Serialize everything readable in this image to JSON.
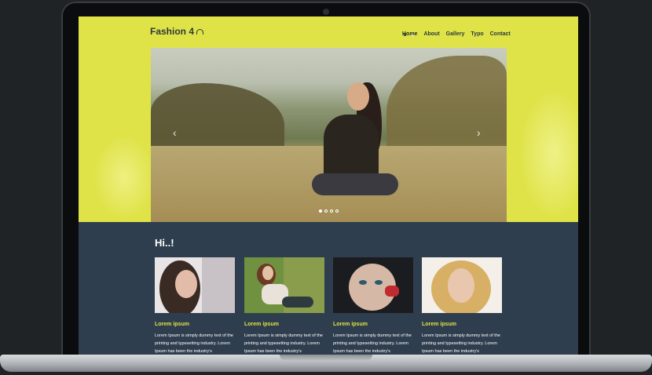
{
  "site": {
    "logo_text": "Fashion 4",
    "nav": [
      {
        "label": "Home"
      },
      {
        "label": "About"
      },
      {
        "label": "Gallery"
      },
      {
        "label": "Typo"
      },
      {
        "label": "Contact"
      }
    ]
  },
  "slider": {
    "prev_arrow": "‹",
    "next_arrow": "›",
    "active_slide_index": 0,
    "slide_count": 4
  },
  "content": {
    "heading": "Hi..!",
    "cards": [
      {
        "title": "Lorem ipsum",
        "text": "Lorem Ipsum is simply dummy text of the printing and typesetting industry. Lorem Ipsum has been the industry's"
      },
      {
        "title": "Lorem ipsum",
        "text": "Lorem Ipsum is simply dummy text of the printing and typesetting industry. Lorem Ipsum has been the industry's"
      },
      {
        "title": "Lorem ipsum",
        "text": "Lorem Ipsum is simply dummy text of the printing and typesetting industry. Lorem Ipsum has been the industry's"
      },
      {
        "title": "Lorem ipsum",
        "text": "Lorem Ipsum is simply dummy text of the printing and typesetting industry. Lorem Ipsum has been the industry's"
      }
    ]
  },
  "colors": {
    "accent": "#dfe347",
    "dark_section": "#2f3e4e",
    "nav_text": "#2d3a3a"
  }
}
